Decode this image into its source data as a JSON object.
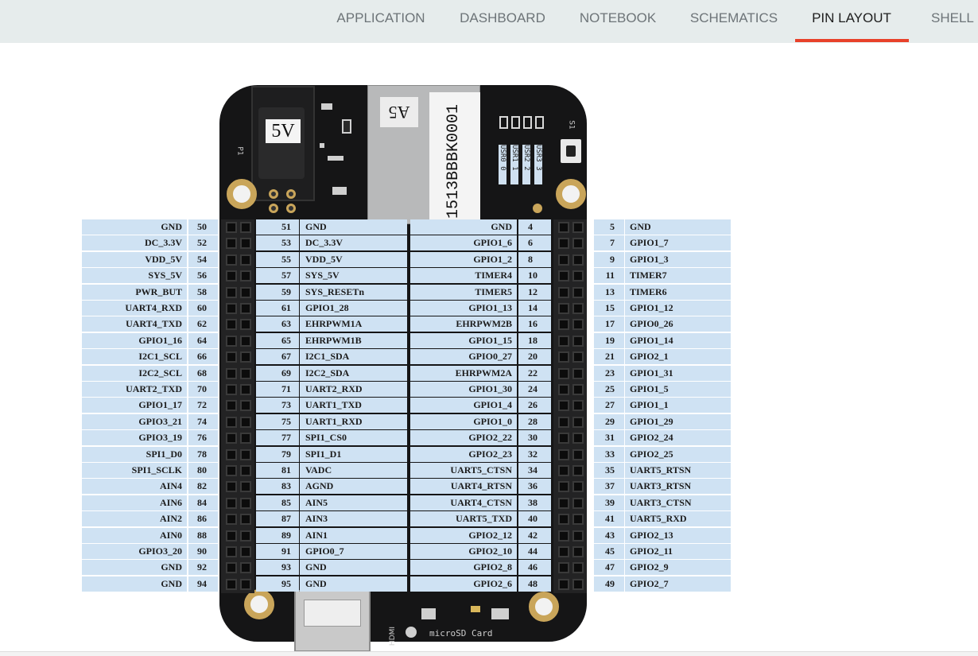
{
  "tabs": [
    {
      "id": "application",
      "label": "APPLICATION",
      "active": false
    },
    {
      "id": "dashboard",
      "label": "DASHBOARD",
      "active": false
    },
    {
      "id": "notebook",
      "label": "NOTEBOOK",
      "active": false
    },
    {
      "id": "schematics",
      "label": "SCHEMATICS",
      "active": false
    },
    {
      "id": "pin-layout",
      "label": "PIN LAYOUT",
      "active": true
    },
    {
      "id": "shell",
      "label": "SHELL",
      "active": false
    }
  ],
  "colors": {
    "accent": "#e8412a",
    "topbar_bg": "#e6ecec",
    "cell_bg": "#cfe2f3",
    "board": "#151516"
  },
  "board": {
    "power_label": "5V",
    "eth_label": "A5",
    "serial": "1513BBBK0001",
    "usr_leds": [
      "USR0 0",
      "USR1 1",
      "USR2 2",
      "USR3 3"
    ],
    "silk_p1": "P1",
    "silk_s1": "S1",
    "silk_micro_sd": "microSD Card",
    "silk_hdmi": "HDMI"
  },
  "p9_left": [
    {
      "name": "GND",
      "num": "50"
    },
    {
      "name": "DC_3.3V",
      "num": "52"
    },
    {
      "name": "VDD_5V",
      "num": "54"
    },
    {
      "name": "SYS_5V",
      "num": "56"
    },
    {
      "name": "PWR_BUT",
      "num": "58"
    },
    {
      "name": "UART4_RXD",
      "num": "60"
    },
    {
      "name": "UART4_TXD",
      "num": "62"
    },
    {
      "name": "GPIO1_16",
      "num": "64"
    },
    {
      "name": "I2C1_SCL",
      "num": "66"
    },
    {
      "name": "I2C2_SCL",
      "num": "68"
    },
    {
      "name": "UART2_TXD",
      "num": "70"
    },
    {
      "name": "GPIO1_17",
      "num": "72"
    },
    {
      "name": "GPIO3_21",
      "num": "74"
    },
    {
      "name": "GPIO3_19",
      "num": "76"
    },
    {
      "name": "SPI1_D0",
      "num": "78"
    },
    {
      "name": "SPI1_SCLK",
      "num": "80"
    },
    {
      "name": "AIN4",
      "num": "82"
    },
    {
      "name": "AIN6",
      "num": "84"
    },
    {
      "name": "AIN2",
      "num": "86"
    },
    {
      "name": "AIN0",
      "num": "88"
    },
    {
      "name": "GPIO3_20",
      "num": "90"
    },
    {
      "name": "GND",
      "num": "92"
    },
    {
      "name": "GND",
      "num": "94"
    }
  ],
  "p9_right": [
    {
      "num": "51",
      "name": "GND"
    },
    {
      "num": "53",
      "name": "DC_3.3V"
    },
    {
      "num": "55",
      "name": "VDD_5V"
    },
    {
      "num": "57",
      "name": "SYS_5V"
    },
    {
      "num": "59",
      "name": "SYS_RESETn"
    },
    {
      "num": "61",
      "name": "GPIO1_28"
    },
    {
      "num": "63",
      "name": "EHRPWM1A"
    },
    {
      "num": "65",
      "name": "EHRPWM1B"
    },
    {
      "num": "67",
      "name": "I2C1_SDA"
    },
    {
      "num": "69",
      "name": "I2C2_SDA"
    },
    {
      "num": "71",
      "name": "UART2_RXD"
    },
    {
      "num": "73",
      "name": "UART1_TXD"
    },
    {
      "num": "75",
      "name": "UART1_RXD"
    },
    {
      "num": "77",
      "name": "SPI1_CS0"
    },
    {
      "num": "79",
      "name": "SPI1_D1"
    },
    {
      "num": "81",
      "name": "VADC"
    },
    {
      "num": "83",
      "name": "AGND"
    },
    {
      "num": "85",
      "name": "AIN5"
    },
    {
      "num": "87",
      "name": "AIN3"
    },
    {
      "num": "89",
      "name": "AIN1"
    },
    {
      "num": "91",
      "name": "GPIO0_7"
    },
    {
      "num": "93",
      "name": "GND"
    },
    {
      "num": "95",
      "name": "GND"
    }
  ],
  "p8_left": [
    {
      "name": "GND",
      "num": "4"
    },
    {
      "name": "GPIO1_6",
      "num": "6"
    },
    {
      "name": "GPIO1_2",
      "num": "8"
    },
    {
      "name": "TIMER4",
      "num": "10"
    },
    {
      "name": "TIMER5",
      "num": "12"
    },
    {
      "name": "GPIO1_13",
      "num": "14"
    },
    {
      "name": "EHRPWM2B",
      "num": "16"
    },
    {
      "name": "GPIO1_15",
      "num": "18"
    },
    {
      "name": "GPIO0_27",
      "num": "20"
    },
    {
      "name": "EHRPWM2A",
      "num": "22"
    },
    {
      "name": "GPIO1_30",
      "num": "24"
    },
    {
      "name": "GPIO1_4",
      "num": "26"
    },
    {
      "name": "GPIO1_0",
      "num": "28"
    },
    {
      "name": "GPIO2_22",
      "num": "30"
    },
    {
      "name": "GPIO2_23",
      "num": "32"
    },
    {
      "name": "UART5_CTSN",
      "num": "34"
    },
    {
      "name": "UART4_RTSN",
      "num": "36"
    },
    {
      "name": "UART4_CTSN",
      "num": "38"
    },
    {
      "name": "UART5_TXD",
      "num": "40"
    },
    {
      "name": "GPIO2_12",
      "num": "42"
    },
    {
      "name": "GPIO2_10",
      "num": "44"
    },
    {
      "name": "GPIO2_8",
      "num": "46"
    },
    {
      "name": "GPIO2_6",
      "num": "48"
    }
  ],
  "p8_right": [
    {
      "num": "5",
      "name": "GND"
    },
    {
      "num": "7",
      "name": "GPIO1_7"
    },
    {
      "num": "9",
      "name": "GPIO1_3"
    },
    {
      "num": "11",
      "name": "TIMER7"
    },
    {
      "num": "13",
      "name": "TIMER6"
    },
    {
      "num": "15",
      "name": "GPIO1_12"
    },
    {
      "num": "17",
      "name": "GPIO0_26"
    },
    {
      "num": "19",
      "name": "GPIO1_14"
    },
    {
      "num": "21",
      "name": "GPIO2_1"
    },
    {
      "num": "23",
      "name": "GPIO1_31"
    },
    {
      "num": "25",
      "name": "GPIO1_5"
    },
    {
      "num": "27",
      "name": "GPIO1_1"
    },
    {
      "num": "29",
      "name": "GPIO1_29"
    },
    {
      "num": "31",
      "name": "GPIO2_24"
    },
    {
      "num": "33",
      "name": "GPIO2_25"
    },
    {
      "num": "35",
      "name": "UART5_RTSN"
    },
    {
      "num": "37",
      "name": "UART3_RTSN"
    },
    {
      "num": "39",
      "name": "UART3_CTSN"
    },
    {
      "num": "41",
      "name": "UART5_RXD"
    },
    {
      "num": "43",
      "name": "GPIO2_13"
    },
    {
      "num": "45",
      "name": "GPIO2_11"
    },
    {
      "num": "47",
      "name": "GPIO2_9"
    },
    {
      "num": "49",
      "name": "GPIO2_7"
    }
  ]
}
